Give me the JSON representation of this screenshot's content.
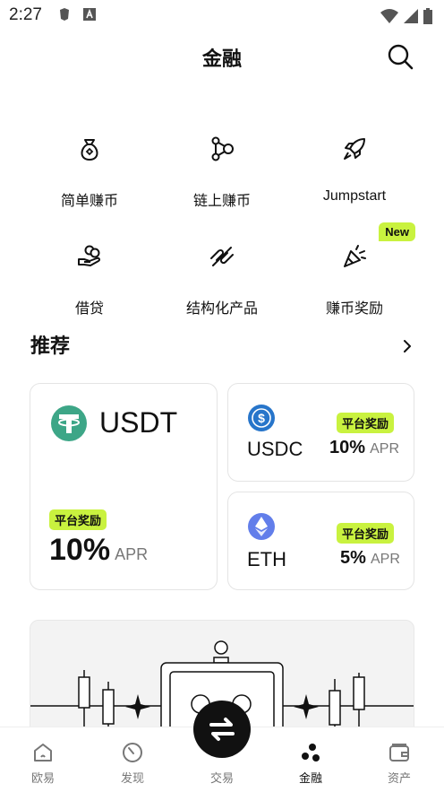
{
  "status": {
    "time": "2:27"
  },
  "header": {
    "title": "金融"
  },
  "grid": [
    {
      "label": "简单赚币",
      "icon": "money-bag-icon"
    },
    {
      "label": "链上赚币",
      "icon": "chain-nodes-icon"
    },
    {
      "label": "Jumpstart",
      "icon": "rocket-icon"
    },
    {
      "label": "借贷",
      "icon": "hand-coins-icon"
    },
    {
      "label": "结构化产品",
      "icon": "structured-product-icon"
    },
    {
      "label": "赚币奖励",
      "icon": "party-popper-icon",
      "badge": "New"
    }
  ],
  "recommend": {
    "title": "推荐",
    "cards": [
      {
        "coin": "USDT",
        "tag": "平台奖励",
        "apr": "10%",
        "apr_unit": "APR",
        "color": "#3da687"
      },
      {
        "coin": "USDC",
        "tag": "平台奖励",
        "apr": "10%",
        "apr_unit": "APR",
        "color": "#2775ca"
      },
      {
        "coin": "ETH",
        "tag": "平台奖励",
        "apr": "5%",
        "apr_unit": "APR",
        "color": "#627eea"
      }
    ]
  },
  "tabbar": [
    {
      "label": "欧易",
      "icon": "home-icon"
    },
    {
      "label": "发现",
      "icon": "discover-icon"
    },
    {
      "label": "交易",
      "icon": "swap-icon"
    },
    {
      "label": "金融",
      "icon": "finance-icon",
      "active": true
    },
    {
      "label": "资产",
      "icon": "wallet-icon"
    }
  ],
  "colors": {
    "accent": "#c9f23f",
    "text": "#111111",
    "muted": "#777777"
  }
}
